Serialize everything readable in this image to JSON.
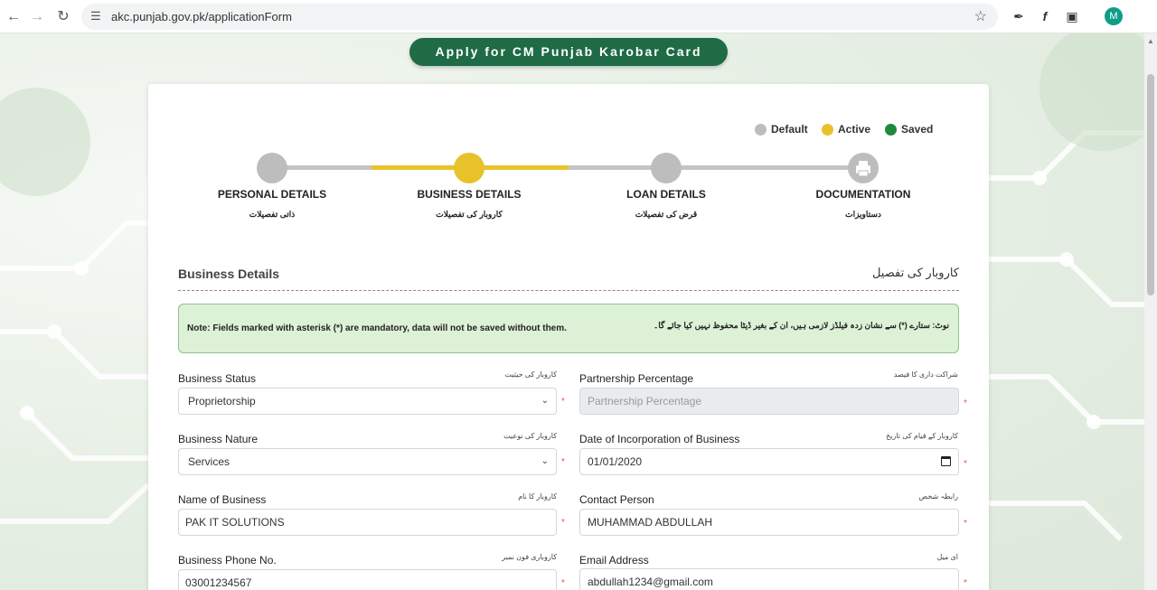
{
  "browser": {
    "url": "akc.punjab.gov.pk/applicationForm",
    "avatar_letter": "M"
  },
  "header": {
    "title": "Apply for CM Punjab Karobar Card"
  },
  "legend": {
    "default_label": "Default",
    "active_label": "Active",
    "saved_label": "Saved",
    "colors": {
      "default": "#bdbdbd",
      "active": "#e8c22b",
      "saved": "#1e8a3e"
    }
  },
  "steps": [
    {
      "title": "PERSONAL DETAILS",
      "urdu": "ذاتی تفصیلات",
      "state": "default"
    },
    {
      "title": "BUSINESS DETAILS",
      "urdu": "کاروبار کی تفصیلات",
      "state": "active"
    },
    {
      "title": "LOAN DETAILS",
      "urdu": "قرض کی تفصیلات",
      "state": "default"
    },
    {
      "title": "DOCUMENTATION",
      "urdu": "دستاویزات",
      "state": "default"
    }
  ],
  "section": {
    "title": "Business Details",
    "urdu": "کاروبار کی تفصیل"
  },
  "note": {
    "en": "Note: Fields marked with asterisk (*) are mandatory, data will not be saved without them.",
    "ur": "نوٹ: ستارے (*) سے نشان زدہ فیلڈز لازمی ہیں، ان کے بغیر ڈیٹا محفوظ نہیں کیا جائے گا۔"
  },
  "form": {
    "business_status": {
      "label": "Business Status",
      "urdu": "کاروبار کی حیثیت",
      "value": "Proprietorship"
    },
    "partnership_percentage": {
      "label": "Partnership Percentage",
      "urdu": "شراکت داری کا فیصد",
      "placeholder": "Partnership Percentage"
    },
    "business_nature": {
      "label": "Business Nature",
      "urdu": "کاروبار کی نوعیت",
      "value": "Services"
    },
    "date_of_incorporation": {
      "label": "Date of Incorporation of Business",
      "urdu": "کاروبار کے قیام کی تاریخ",
      "value": "01/01/2020"
    },
    "name_of_business": {
      "label": "Name of Business",
      "urdu": "کاروبار کا نام",
      "value": "PAK IT SOLUTIONS"
    },
    "contact_person": {
      "label": "Contact Person",
      "urdu": "رابطہ شخص",
      "value": "MUHAMMAD ABDULLAH"
    },
    "business_phone": {
      "label": "Business Phone No.",
      "urdu": "کاروباری فون نمبر",
      "value": "03001234567"
    },
    "email_address": {
      "label": "Email Address",
      "urdu": "ای میل",
      "value": "abdullah1234@gmail.com"
    },
    "required_marker": "*"
  },
  "icons": {
    "back": "arrow-left-icon",
    "forward": "arrow-right-icon",
    "reload": "reload-icon",
    "site_info": "tune-icon",
    "bookmark": "star-icon",
    "eyedropper": "eyedropper-icon",
    "font": "font-icon",
    "extensions": "puzzle-icon",
    "documentation_step": "printer-icon"
  }
}
